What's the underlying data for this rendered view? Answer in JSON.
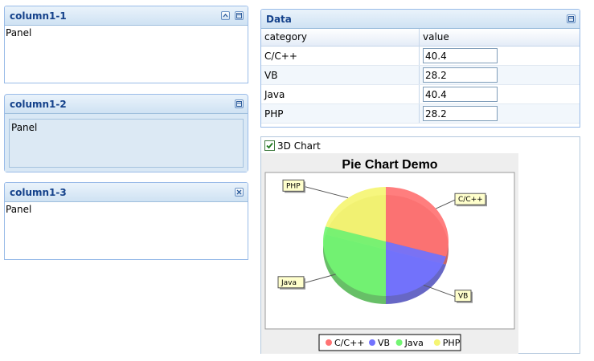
{
  "panels": {
    "column1_1": {
      "title": "column1-1",
      "body": "Panel"
    },
    "column1_2": {
      "title": "column1-2",
      "body": "Panel"
    },
    "column1_3": {
      "title": "column1-3",
      "body": "Panel"
    },
    "data": {
      "title": "Data",
      "columns": [
        "category",
        "value"
      ],
      "rows": [
        {
          "category": "C/C++",
          "value": "40.4"
        },
        {
          "category": "VB",
          "value": "28.2"
        },
        {
          "category": "Java",
          "value": "40.4"
        },
        {
          "category": "PHP",
          "value": "28.2"
        }
      ]
    },
    "chart": {
      "checkbox_label": "3D Chart",
      "checked": true
    }
  },
  "chart_data": {
    "type": "pie",
    "title": "Pie Chart Demo",
    "categories": [
      "C/C++",
      "VB",
      "Java",
      "PHP"
    ],
    "values": [
      40.4,
      28.2,
      40.4,
      28.2
    ],
    "colors": [
      "#ff7373",
      "#7373ff",
      "#73f573",
      "#f5f573"
    ],
    "three_d": true,
    "legend_position": "bottom"
  }
}
